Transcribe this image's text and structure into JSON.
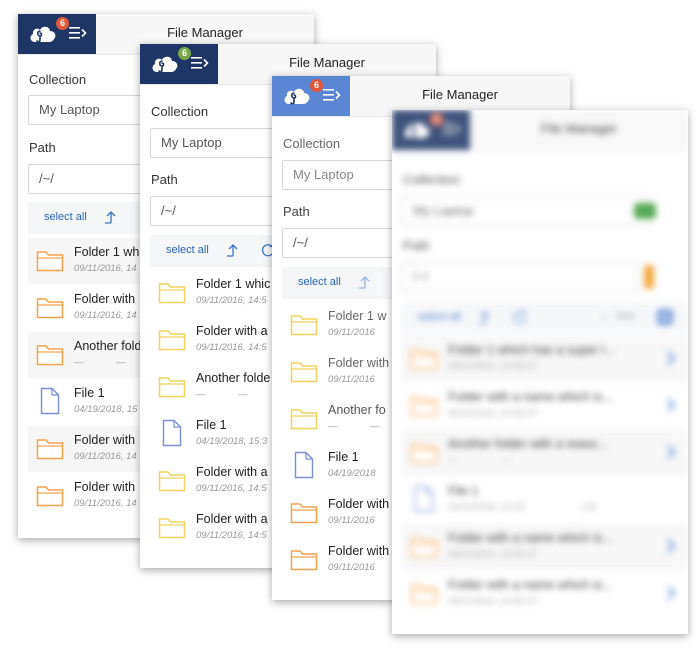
{
  "app": {
    "title": "File Manager",
    "badge_count": "6",
    "colors": {
      "topbar_dark": "#1f3566",
      "topbar_light": "#5b86d4",
      "badge_orange": "#e0573a",
      "badge_green": "#7aa64a",
      "folder_orange": "#f5a24e",
      "folder_yellow": "#f2d361",
      "file_blue": "#7b8fd4",
      "link": "#2a63b8"
    }
  },
  "labels": {
    "collection": "Collection",
    "path": "Path",
    "select_all": "select all",
    "sort": "Sort"
  },
  "fields": {
    "collection_value": "My Laptop",
    "path_value": "/~/"
  },
  "panel1": {
    "rows": [
      {
        "name": "Folder 1 wh",
        "meta": "09/11/2016, 14",
        "size": ""
      },
      {
        "name": "Folder with",
        "meta": "09/11/2016, 14",
        "size": ""
      },
      {
        "name": "Another fold",
        "meta": "—",
        "size": "—"
      },
      {
        "name": "File 1",
        "meta": "04/19/2018, 15",
        "size": ""
      },
      {
        "name": "Folder with",
        "meta": "09/11/2016, 14",
        "size": ""
      },
      {
        "name": "Folder with",
        "meta": "09/11/2016, 14",
        "size": ""
      }
    ]
  },
  "panel2": {
    "rows": [
      {
        "name": "Folder 1 whic",
        "meta": "09/11/2016, 14:5",
        "size": ""
      },
      {
        "name": "Folder with a",
        "meta": "09/11/2016, 14:5",
        "size": ""
      },
      {
        "name": "Another folde",
        "meta": "—",
        "size": "—"
      },
      {
        "name": "File 1",
        "meta": "04/19/2018, 15:3",
        "size": ""
      },
      {
        "name": "Folder with a",
        "meta": "09/11/2016, 14:5",
        "size": ""
      },
      {
        "name": "Folder with a",
        "meta": "09/11/2016, 14:5",
        "size": ""
      }
    ]
  },
  "panel3": {
    "rows": [
      {
        "name": "Folder 1 w",
        "meta": "09/11/2016",
        "size": ""
      },
      {
        "name": "Folder with",
        "meta": "09/11/2016",
        "size": ""
      },
      {
        "name": "Another fo",
        "meta": "—",
        "size": "—"
      },
      {
        "name": "File 1",
        "meta": "04/19/2018",
        "size": ""
      },
      {
        "name": "Folder with",
        "meta": "09/11/2016",
        "size": ""
      },
      {
        "name": "Folder with",
        "meta": "09/11/2016",
        "size": ""
      }
    ]
  },
  "panel4": {
    "rows": [
      {
        "name": "Folder 1 which has a super l...",
        "meta": "09/11/2016, 14:55:37",
        "size": ""
      },
      {
        "name": "Folder with a name which is...",
        "meta": "09/11/2016, 14:55:37",
        "size": ""
      },
      {
        "name": "Another folder with a reaso...",
        "meta": "—",
        "size": "—"
      },
      {
        "name": "File 1",
        "meta": "04/19/2018, 15:33",
        "size": "0 B"
      },
      {
        "name": "Folder with a name which is...",
        "meta": "09/11/2016, 14:55:37",
        "size": ""
      },
      {
        "name": "Folder with a name which is...",
        "meta": "09/11/2016, 14:55:37",
        "size": ""
      }
    ]
  }
}
